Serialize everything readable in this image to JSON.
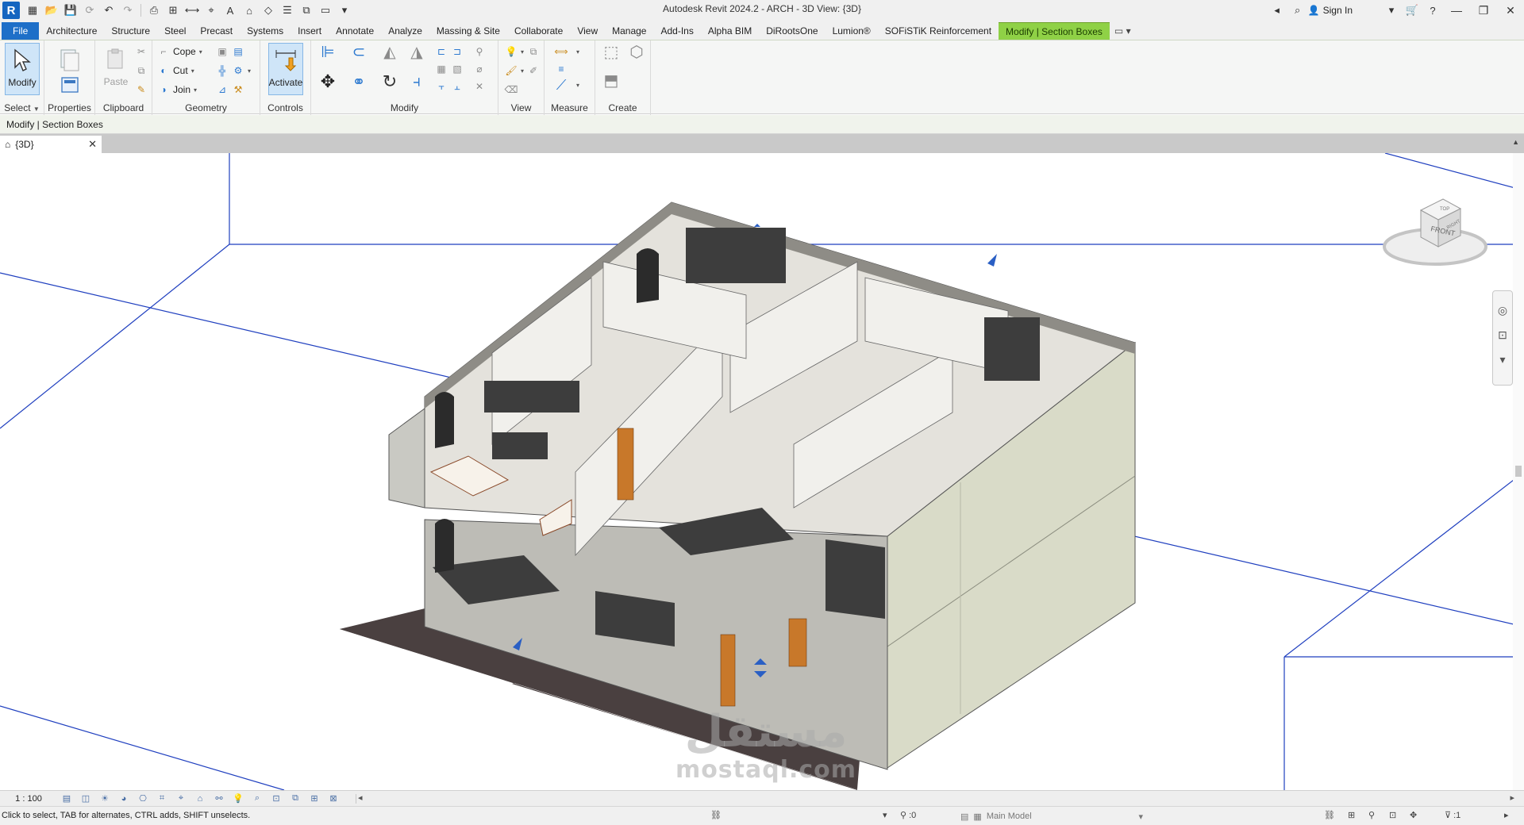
{
  "app": {
    "title": "Autodesk Revit 2024.2 - ARCH - 3D View: {3D}",
    "logo_letter": "R",
    "sign_in": "Sign In"
  },
  "ribbon_tabs": [
    {
      "label": "File"
    },
    {
      "label": "Architecture"
    },
    {
      "label": "Structure"
    },
    {
      "label": "Steel"
    },
    {
      "label": "Precast"
    },
    {
      "label": "Systems"
    },
    {
      "label": "Insert"
    },
    {
      "label": "Annotate"
    },
    {
      "label": "Analyze"
    },
    {
      "label": "Massing & Site"
    },
    {
      "label": "Collaborate"
    },
    {
      "label": "View"
    },
    {
      "label": "Manage"
    },
    {
      "label": "Add-Ins"
    },
    {
      "label": "Alpha BIM"
    },
    {
      "label": "DiRootsOne"
    },
    {
      "label": "Lumion®"
    },
    {
      "label": "SOFiSTiK Reinforcement"
    },
    {
      "label": "Modify | Section Boxes"
    }
  ],
  "ribbon": {
    "modify_label": "Modify",
    "properties_label": "Properties",
    "paste_label": "Paste",
    "cope_label": "Cope",
    "cut_label": "Cut",
    "join_label": "Join",
    "activate_label": "Activate",
    "panels": {
      "select": "Select",
      "properties": "Properties",
      "clipboard": "Clipboard",
      "geometry": "Geometry",
      "controls": "Controls",
      "modify": "Modify",
      "view": "View",
      "measure": "Measure",
      "create": "Create"
    }
  },
  "options_bar": {
    "label": "Modify | Section Boxes"
  },
  "view_tab": {
    "label": "{3D}"
  },
  "viewcube": {
    "top": "TOP",
    "front": "FRONT",
    "right": "RIGHT"
  },
  "watermark": {
    "arabic": "مستقل",
    "latin": "mostaql.com"
  },
  "view_control": {
    "scale": "1 : 100"
  },
  "status": {
    "message": "Click to select, TAB for alternates, CTRL adds, SHIFT unselects.",
    "worksets": ":0",
    "model": "Main Model",
    "filter_count": ":1"
  },
  "colors": {
    "file_tab": "#1e6fc8",
    "context_tab": "#8fd146",
    "section_box_line": "#1f3fbf",
    "floor_slab": "#4a4040"
  }
}
